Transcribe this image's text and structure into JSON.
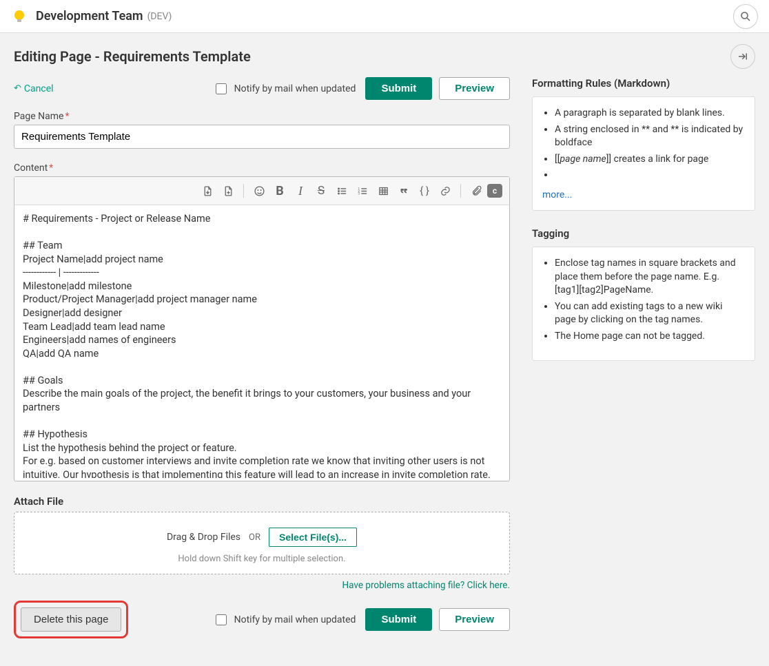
{
  "header": {
    "project_name": "Development Team",
    "project_code": "(DEV)"
  },
  "page": {
    "title": "Editing Page - Requirements Template",
    "cancel": "Cancel",
    "notify_label": "Notify by mail when updated",
    "submit": "Submit",
    "preview": "Preview"
  },
  "form": {
    "page_name_label": "Page Name",
    "page_name_value": "Requirements Template",
    "content_label": "Content",
    "content_value": "# Requirements - Project or Release Name\n\n## Team\nProject Name|add project name\n------------ | -------------\nMilestone|add milestone\nProduct/Project Manager|add project manager name\nDesigner|add designer\nTeam Lead|add team lead name\nEngineers|add names of engineers\nQA|add QA name\n\n## Goals\nDescribe the main goals of the project, the benefit it brings to your customers, your business and your partners\n\n## Hypothesis\nList the hypothesis behind the project or feature.\nFor e.g. based on customer interviews and invite completion rate we know that inviting other users is not intuitive. Our hypothesis is that implementing this feature will lead to an increase in invite completion rate. We will know this when we see an increase in invite completion rate"
  },
  "toolbar": {
    "bold": "B",
    "italic": "I",
    "strike": "S",
    "braces": "{ }",
    "badge": "c"
  },
  "attach": {
    "section_label": "Attach File",
    "drag_text": "Drag & Drop Files",
    "or": "OR",
    "select_btn": "Select File(s)...",
    "hint": "Hold down Shift key for multiple selection.",
    "problems": "Have problems attaching file? Click here."
  },
  "bottom": {
    "delete_btn": "Delete this page",
    "notify_label": "Notify by mail when updated",
    "submit": "Submit",
    "preview": "Preview"
  },
  "sidebar": {
    "formatting": {
      "heading": "Formatting Rules (Markdown)",
      "items": [
        "A paragraph is separated by blank lines.",
        "A string enclosed in ** and ** is indicated by boldface",
        "[[page name]] creates a link for page",
        ""
      ],
      "item2_prefix": "[[",
      "item2_italic": "page name",
      "item2_suffix": "]] creates a link for page",
      "more": "more..."
    },
    "tagging": {
      "heading": "Tagging",
      "items": [
        "Enclose tag names in square brackets and place them before the page name. E.g. [tag1][tag2]PageName.",
        "You can add existing tags to a new wiki page by clicking on the tag names.",
        "The Home page can not be tagged."
      ]
    }
  }
}
